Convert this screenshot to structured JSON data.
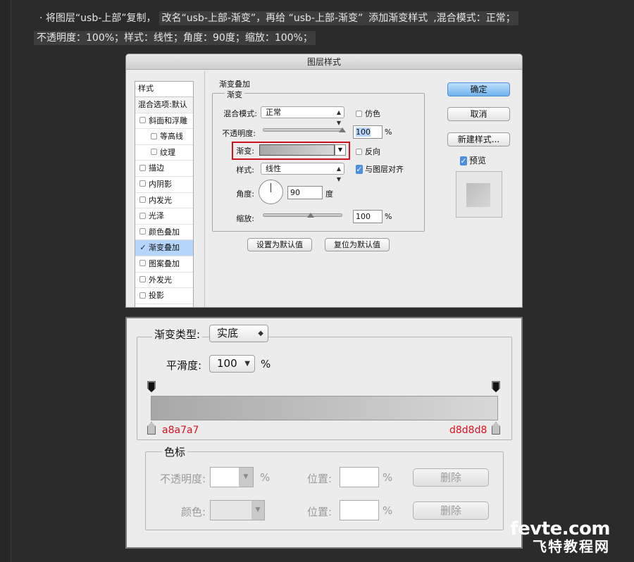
{
  "instruction": {
    "part1": "· 将图层“usb-上部”复制，",
    "part2": "改名“usb-上部-渐变”，再给 “usb-上部-渐变”",
    "part3": "添加渐变样式",
    "part4": ",混合模式：正常；",
    "part5": "不透明度：100%；样式：线性；角度：90度；缩放：100%；"
  },
  "layer_style": {
    "title": "图层样式",
    "sidebar_header": "样式",
    "items": [
      {
        "label": "混合选项:默认",
        "checked": null
      },
      {
        "label": "斜面和浮雕",
        "checked": false
      },
      {
        "label": "等高线",
        "checked": false
      },
      {
        "label": "纹理",
        "checked": false
      },
      {
        "label": "描边",
        "checked": false
      },
      {
        "label": "内阴影",
        "checked": false
      },
      {
        "label": "内发光",
        "checked": false
      },
      {
        "label": "光泽",
        "checked": false
      },
      {
        "label": "颜色叠加",
        "checked": false
      },
      {
        "label": "渐变叠加",
        "checked": true
      },
      {
        "label": "图案叠加",
        "checked": false
      },
      {
        "label": "外发光",
        "checked": false
      },
      {
        "label": "投影",
        "checked": false
      }
    ],
    "section_title": "渐变叠加",
    "subsection_title": "渐变",
    "blend_label": "混合模式:",
    "blend_value": "正常",
    "dither_label": "仿色",
    "opacity_label": "不透明度:",
    "opacity_value": "100",
    "pct": "%",
    "gradient_label": "渐变:",
    "reverse_label": "反向",
    "style_label": "样式:",
    "style_value": "线性",
    "align_label": "与图层对齐",
    "angle_label": "角度:",
    "angle_value": "90",
    "deg": "度",
    "scale_label": "缩放:",
    "scale_value": "100",
    "make_default": "设置为默认值",
    "reset_default": "复位为默认值",
    "ok": "确定",
    "cancel": "取消",
    "new_style": "新建样式...",
    "preview": "预览",
    "opacity_fraction": 1.0,
    "scale_fraction": 0.6
  },
  "gradient_editor": {
    "type_label": "渐变类型:",
    "type_value": "实底",
    "smooth_label": "平滑度:",
    "smooth_value": "100",
    "pct": "%",
    "stop_left_color": "a8a7a7",
    "stop_right_color": "d8d8d8",
    "stops_title": "色标",
    "opacity_label": "不透明度:",
    "color_label": "颜色:",
    "position_label": "位置:",
    "delete_label": "删除"
  },
  "watermark": {
    "line1": "fevte.com",
    "line2": "飞特教程网"
  },
  "colors": {
    "stop_left": "#a8a7a7",
    "stop_right": "#d8d8d8",
    "highlight_red": "#d2101e"
  }
}
